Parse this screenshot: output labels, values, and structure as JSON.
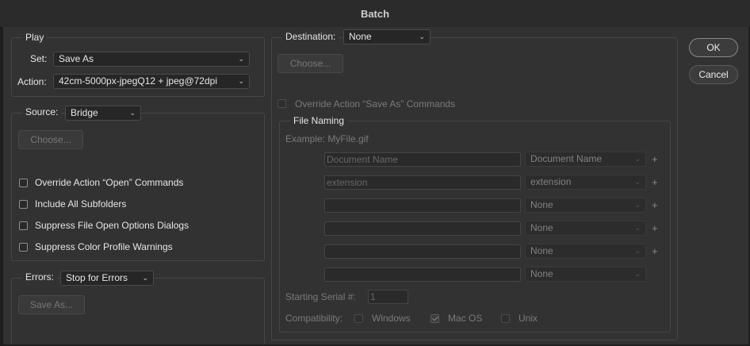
{
  "window": {
    "title": "Batch"
  },
  "buttons": {
    "ok": "OK",
    "cancel": "Cancel"
  },
  "play": {
    "legend": "Play",
    "set_label": "Set:",
    "set_value": "Save As",
    "action_label": "Action:",
    "action_value": "42cm-5000px-jpegQ12 + jpeg@72dpi"
  },
  "source": {
    "label": "Source:",
    "value": "Bridge",
    "choose": "Choose...",
    "options": [
      {
        "label": "Override Action “Open” Commands",
        "checked": false
      },
      {
        "label": "Include All Subfolders",
        "checked": false
      },
      {
        "label": "Suppress File Open Options Dialogs",
        "checked": false
      },
      {
        "label": "Suppress Color Profile Warnings",
        "checked": false
      }
    ]
  },
  "errors": {
    "label": "Errors:",
    "value": "Stop for Errors",
    "save_as": "Save As..."
  },
  "destination": {
    "label": "Destination:",
    "value": "None",
    "choose": "Choose...",
    "override_label": "Override Action “Save As” Commands",
    "override_checked": false
  },
  "file_naming": {
    "legend": "File Naming",
    "example": "Example: MyFile.gif",
    "rows": [
      {
        "field": "Document Name",
        "select": "Document Name",
        "plus": "+"
      },
      {
        "field": "extension",
        "select": "extension",
        "plus": "+"
      },
      {
        "field": "",
        "select": "None",
        "plus": "+"
      },
      {
        "field": "",
        "select": "None",
        "plus": "+"
      },
      {
        "field": "",
        "select": "None",
        "plus": "+"
      },
      {
        "field": "",
        "select": "None",
        "plus": ""
      }
    ],
    "serial_label": "Starting Serial #:",
    "serial_value": "1",
    "compat_label": "Compatibility:",
    "compat": [
      {
        "label": "Windows",
        "checked": false
      },
      {
        "label": "Mac OS",
        "checked": true
      },
      {
        "label": "Unix",
        "checked": false
      }
    ]
  },
  "icons": {
    "chevron": "chevron-down-icon",
    "checkmark": "checkmark-icon"
  }
}
